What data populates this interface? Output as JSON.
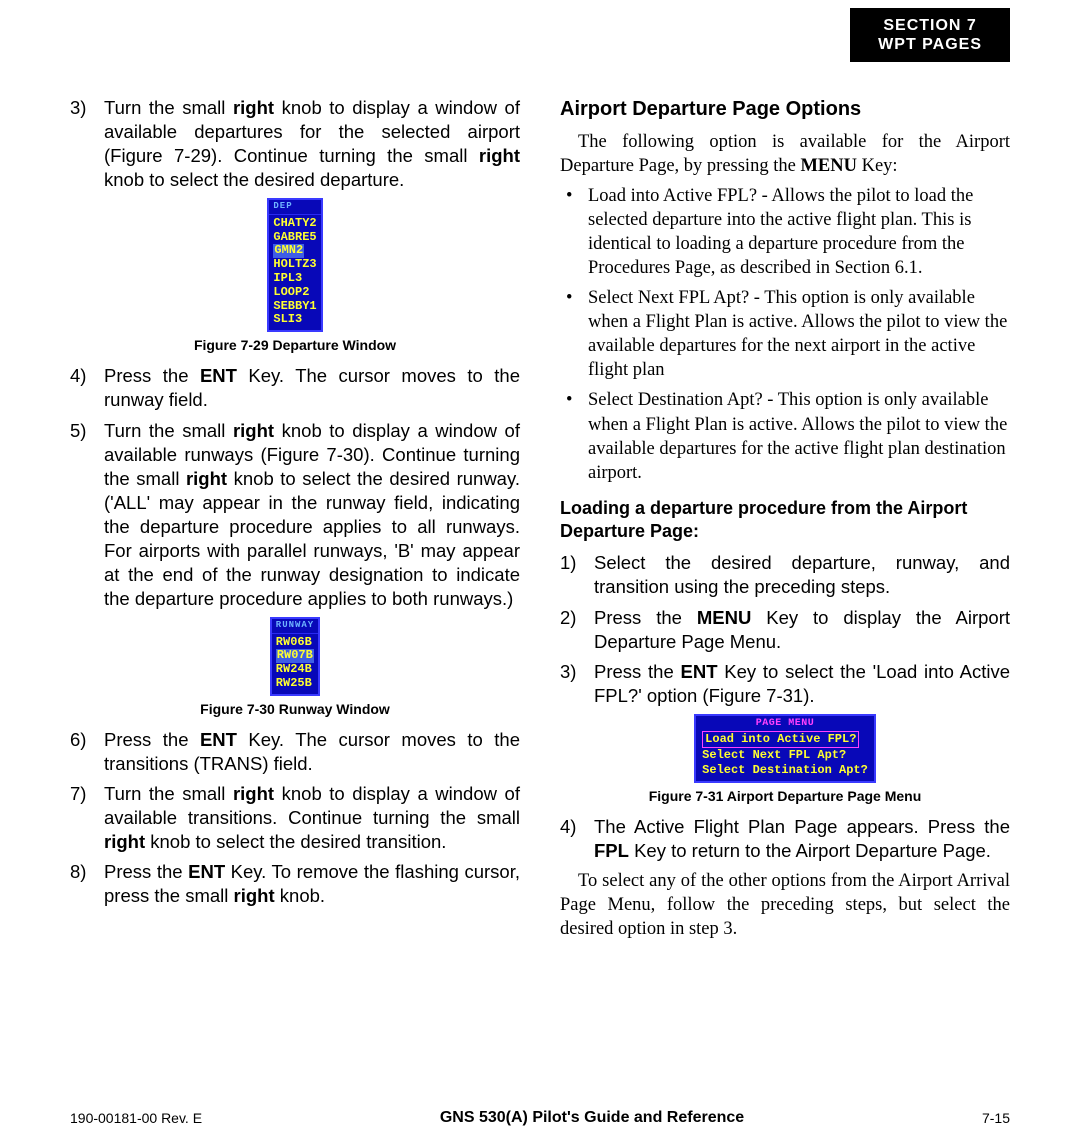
{
  "header": {
    "line1": "SECTION 7",
    "line2": "WPT PAGES"
  },
  "left": {
    "step3_pre": "Turn the small ",
    "step3_b1": "right",
    "step3_mid1": " knob to display a window of available departures for the selected airport (Figure 7-29).  Continue turning the small ",
    "step3_b2": "right",
    "step3_post": " knob to select the desired departure.",
    "fig29": {
      "title": "DEP",
      "items": [
        "CHATY2",
        "GABRE5",
        "GMN2",
        "HOLTZ3",
        "IPL3",
        "LOOP2",
        "SEBBY1",
        "SLI3"
      ],
      "selectedIndex": 2,
      "caption": "Figure 7-29  Departure Window"
    },
    "step4_pre": "Press the ",
    "step4_b": "ENT",
    "step4_post": " Key. The cursor moves to the runway field.",
    "step5_pre": "Turn the small ",
    "step5_b1": "right",
    "step5_mid1": " knob to display a window of available runways (Figure 7-30).  Continue turning the small ",
    "step5_b2": "right",
    "step5_mid2": " knob  to select the desired runway.  ('ALL' may appear in the runway field, indicating the departure procedure applies to all runways.  For airports with parallel runways, 'B' may appear at the end of the runway designation to indicate the departure procedure applies to both runways.)",
    "fig30": {
      "title": "RUNWAY",
      "items": [
        "RW06B",
        "RW07B",
        "RW24B",
        "RW25B"
      ],
      "selectedIndex": 1,
      "caption": "Figure 7-30  Runway Window"
    },
    "step6_pre": "Press the ",
    "step6_b": "ENT",
    "step6_post": " Key.  The cursor moves to the transitions (TRANS) field.",
    "step7_pre": "Turn the small ",
    "step7_b1": "right",
    "step7_mid": " knob to display a window of available transitions.  Continue turning the small ",
    "step7_b2": "right",
    "step7_post": " knob to select the desired transition.",
    "step8_pre": "Press the ",
    "step8_b1": "ENT",
    "step8_mid": " Key.  To remove the flashing cursor, press the small ",
    "step8_b2": "right",
    "step8_post": " knob."
  },
  "right": {
    "heading": "Airport Departure Page Options",
    "intro_pre": "The following option is available for the Airport Departure Page, by pressing the ",
    "intro_b": "MENU",
    "intro_post": " Key:",
    "bullet1": "Load into Active FPL? - Allows the pilot to load the selected departure into the active flight plan.  This is identical to loading a departure procedure from the Procedures Page, as described in Section 6.1.",
    "bullet2": "Select Next FPL Apt? - This option is only available when a Flight Plan is active.  Allows the pilot to view the available departures for the next airport in the active flight plan",
    "bullet3": "Select Destination Apt? - This option is only available when a Flight Plan is active.  Allows the pilot to view the available departures for the active flight plan destination airport.",
    "subheading": "Loading a departure procedure from the Airport Departure Page:",
    "rstep1": "Select the desired departure, runway, and transition using the preceding steps.",
    "rstep2_pre": "Press the ",
    "rstep2_b": "MENU",
    "rstep2_post": " Key to display the Airport Departure Page Menu.",
    "rstep3_pre": "Press the ",
    "rstep3_b": "ENT",
    "rstep3_post": " Key to select the 'Load into Active FPL?' option (Figure 7-31).",
    "fig31": {
      "title": "PAGE MENU",
      "items": [
        "Load into Active FPL?",
        "Select Next FPL Apt?",
        "Select Destination Apt?"
      ],
      "selectedIndex": 0,
      "caption": "Figure 7-31  Airport Departure Page Menu"
    },
    "rstep4_pre": "The Active Flight Plan Page appears.  Press the ",
    "rstep4_b": "FPL",
    "rstep4_post": " Key to return to the Airport Departure Page.",
    "closing": "To select any of the other options from the Airport Arrival Page Menu, follow the preceding steps, but select the desired option in step 3."
  },
  "footer": {
    "rev": "190-00181-00  Rev. E",
    "title": "GNS 530(A) Pilot's Guide and Reference",
    "page": "7-15"
  },
  "nums": {
    "n3": "3)",
    "n4": "4)",
    "n5": "5)",
    "n6": "6)",
    "n7": "7)",
    "n8": "8)",
    "r1": "1)",
    "r2": "2)",
    "r3": "3)",
    "r4": "4)"
  }
}
